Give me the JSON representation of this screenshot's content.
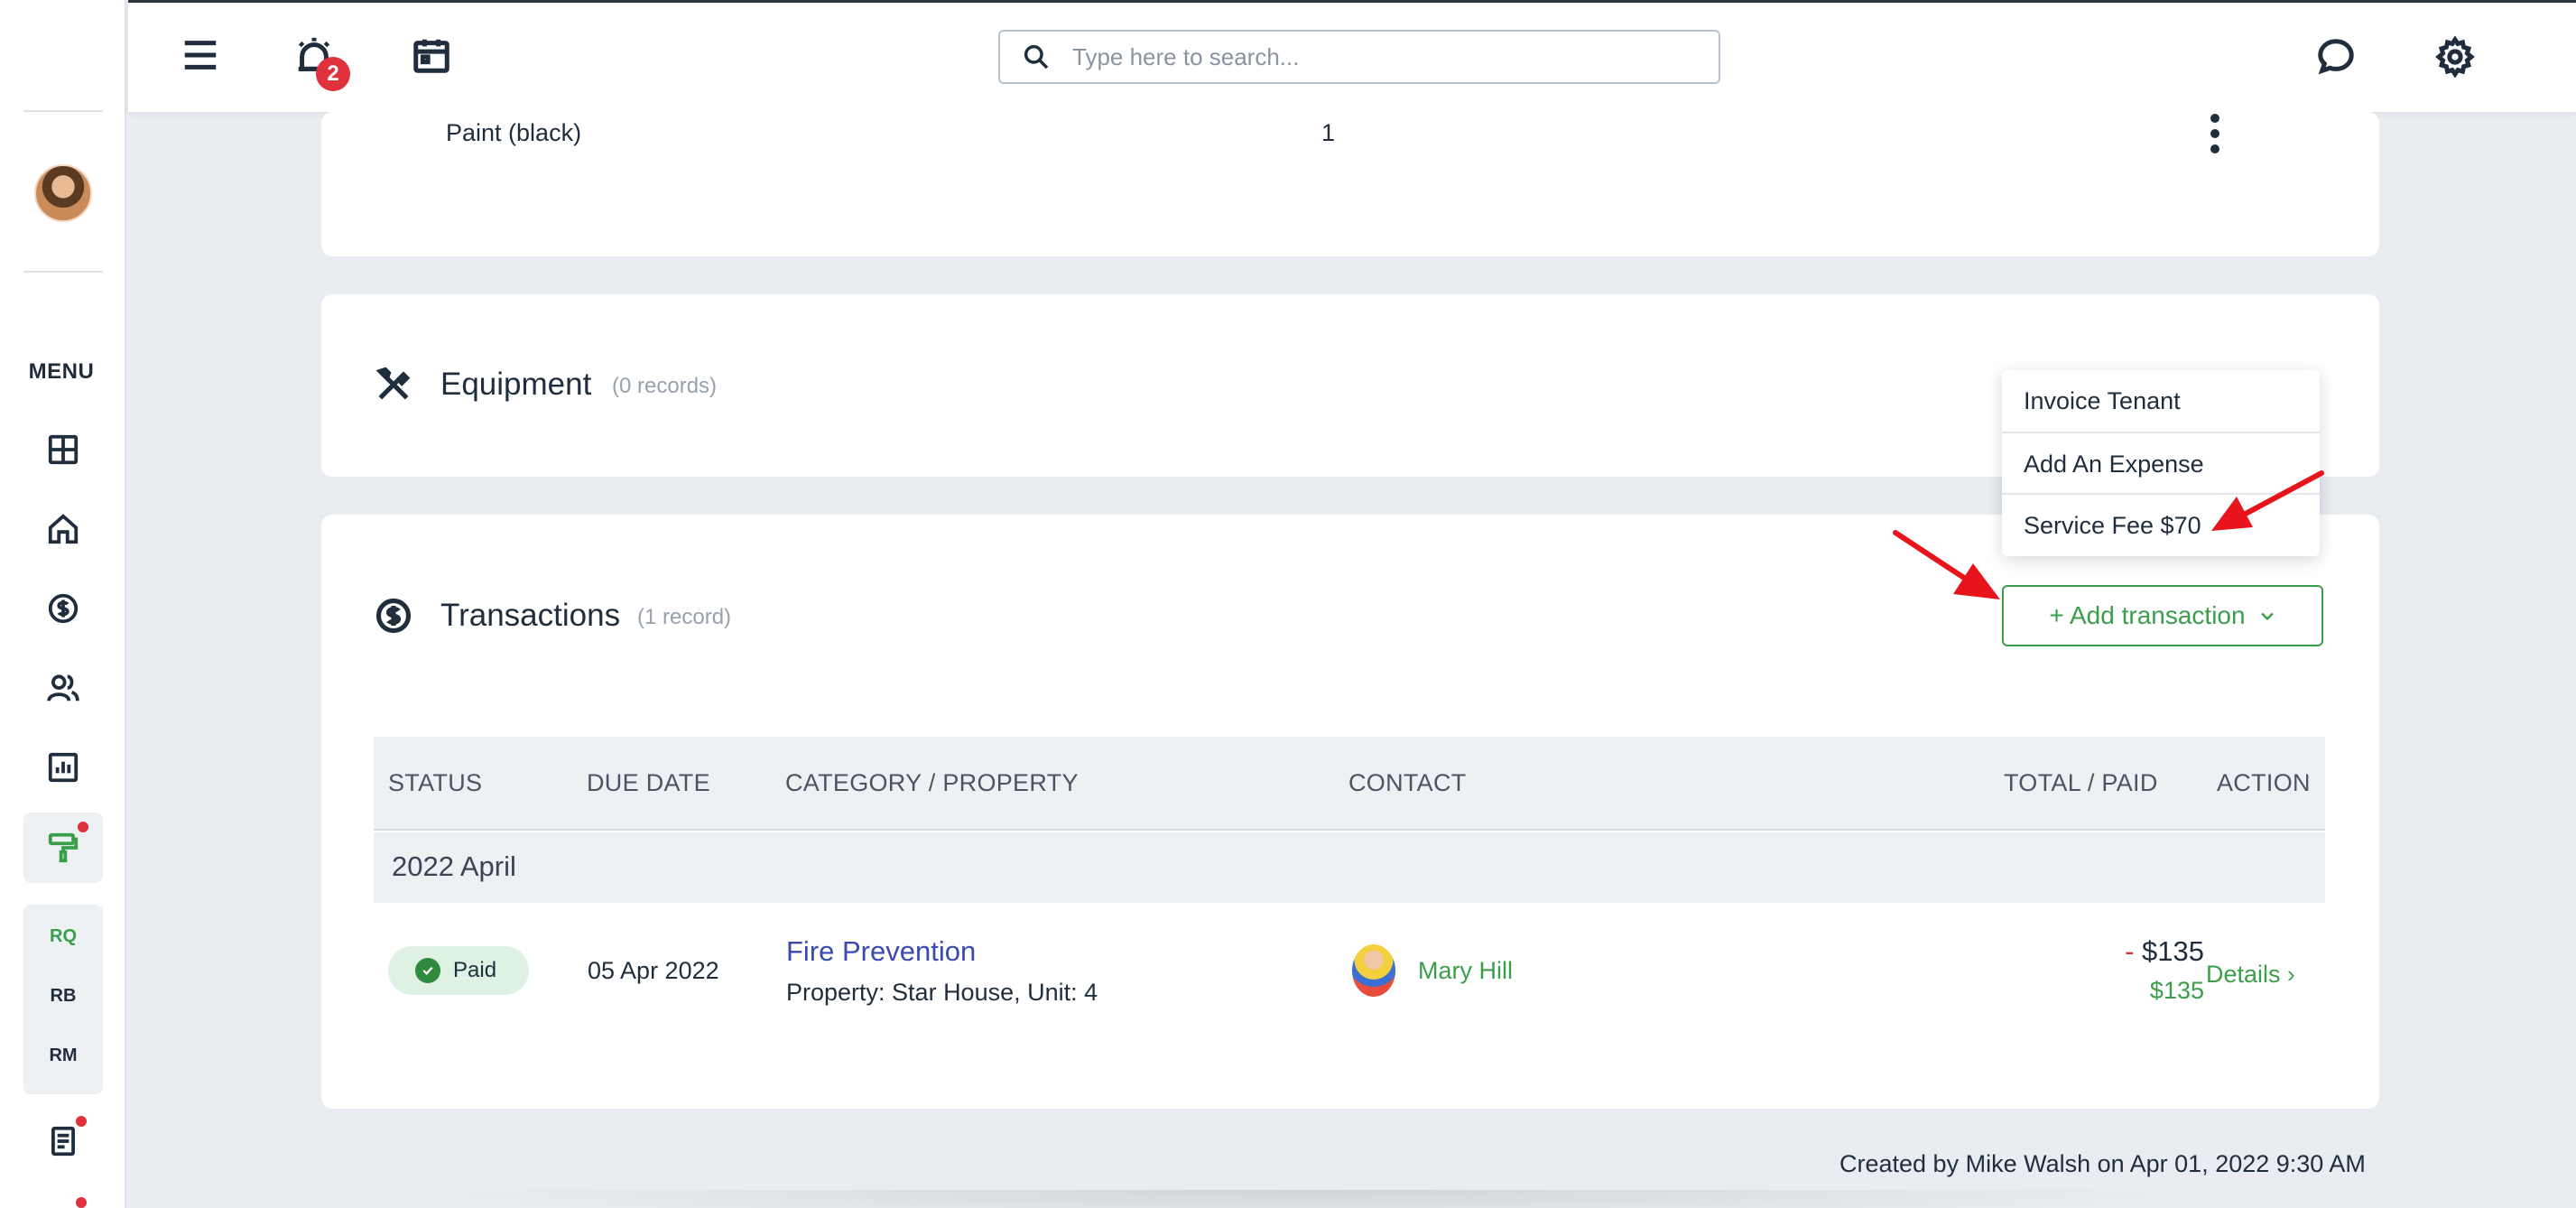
{
  "header": {
    "search_placeholder": "Type here to search...",
    "notifications_count": "2"
  },
  "sidebar": {
    "menu_label": "MENU",
    "sub_items": [
      "RQ",
      "RB",
      "RM"
    ]
  },
  "materials": {
    "row": {
      "name": "Paint (black)",
      "quantity": "1"
    }
  },
  "equipment": {
    "title": "Equipment",
    "count": "(0 records)"
  },
  "transactions": {
    "title": "Transactions",
    "count": "(1 record)",
    "add_button_label": "+ Add transaction",
    "dropdown": [
      "Invoice Tenant",
      "Add An Expense",
      "Service Fee $70"
    ],
    "columns": [
      "STATUS",
      "DUE DATE",
      "CATEGORY / PROPERTY",
      "CONTACT",
      "TOTAL / PAID",
      "ACTION"
    ],
    "group": "2022 April",
    "row": {
      "status": "Paid",
      "due_date": "05 Apr 2022",
      "category": "Fire Prevention",
      "property": "Property: Star House, Unit: 4",
      "contact": "Mary Hill",
      "total_sign": "-",
      "total": "$135",
      "paid": "$135",
      "action": "Details"
    }
  },
  "footer": {
    "created": "Created by Mike Walsh on Apr 01, 2022 9:30 AM"
  },
  "colors": {
    "accent_green": "#3a9e4b",
    "link_blue": "#3b49b0",
    "alert_red": "#e0323c",
    "arrow_red": "#e8141c"
  }
}
